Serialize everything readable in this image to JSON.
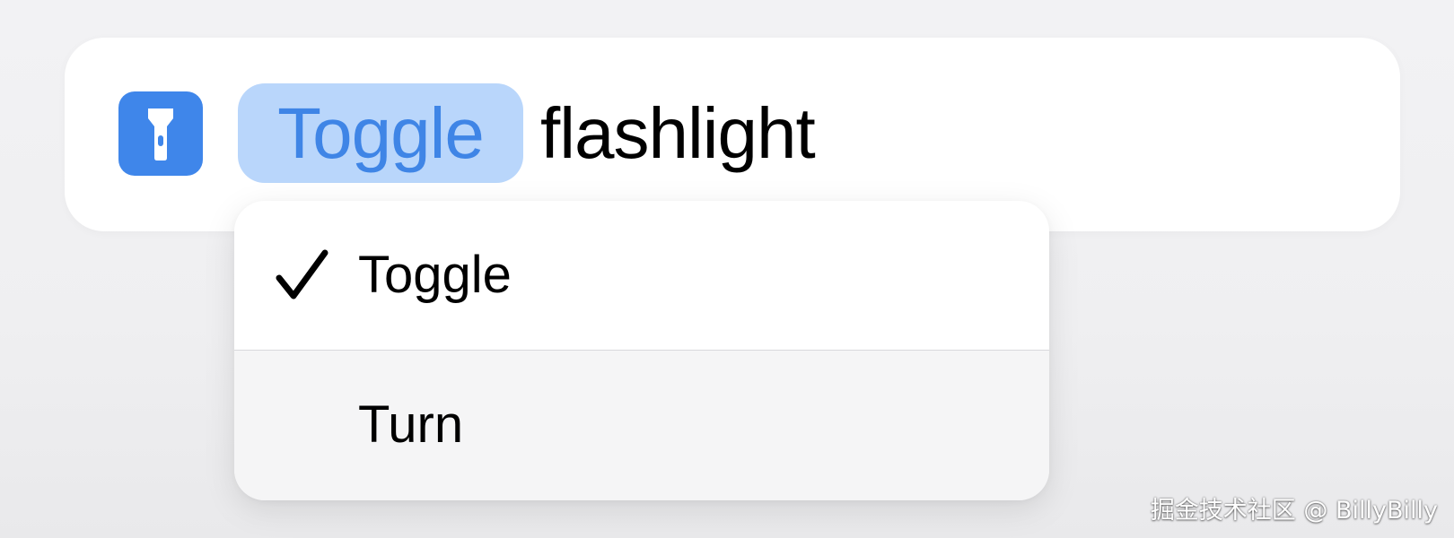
{
  "action": {
    "app_icon": "flashlight-icon",
    "app_icon_color": "#3f86ea",
    "parameter_value": "Toggle",
    "parameter_highlight_color": "#b9d6fb",
    "parameter_text_color": "#3f85e6",
    "text": "flashlight"
  },
  "menu": {
    "items": [
      {
        "label": "Toggle",
        "selected": true,
        "icon": "checkmark-icon"
      },
      {
        "label": "Turn",
        "selected": false
      }
    ]
  },
  "watermark": "掘金技术社区 @ BillyBilly"
}
